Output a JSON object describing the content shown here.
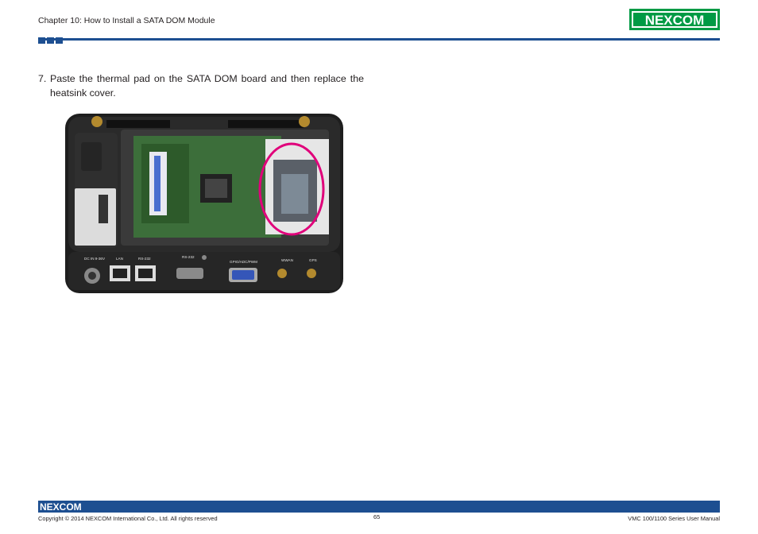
{
  "header": {
    "chapter": "Chapter 10: How to Install a SATA DOM Module",
    "logo_text": "NEXCOM"
  },
  "step": {
    "number": "7.",
    "text": "Paste the thermal pad on the SATA DOM board and then replace the heatsink cover."
  },
  "photo": {
    "port_labels": [
      "DC IN 9-36V",
      "LAN",
      "RS-232",
      "RS-232",
      "GPIO/ADC/PWM",
      "WWAN",
      "GPS"
    ],
    "highlight_color": "#e0007a"
  },
  "footer": {
    "logo_text": "NEXCOM",
    "copyright": "Copyright © 2014 NEXCOM International Co., Ltd. All rights reserved",
    "page": "65",
    "manual": "VMC 100/1100 Series User Manual"
  },
  "colors": {
    "brand_blue": "#1d4f91",
    "brand_green": "#009a44"
  }
}
